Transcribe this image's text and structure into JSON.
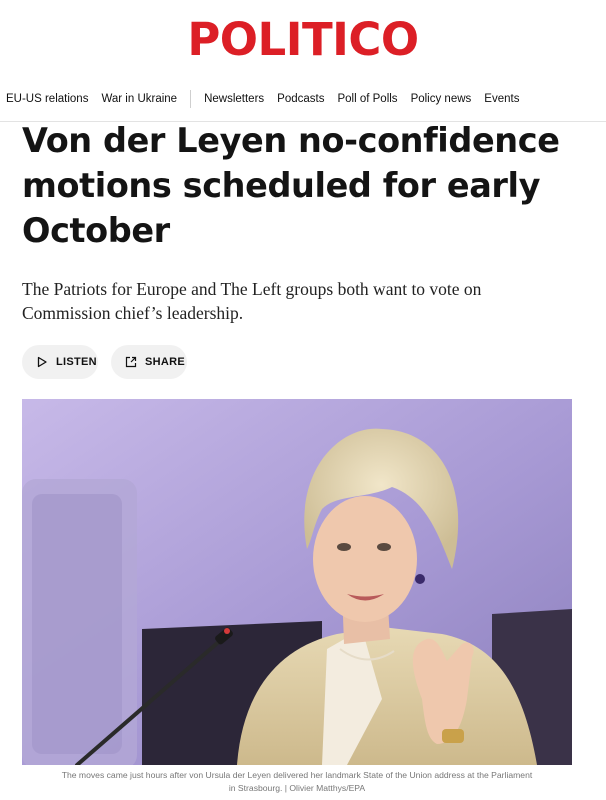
{
  "brand": {
    "name": "POLITICO",
    "color": "#dc1f26"
  },
  "nav": {
    "topics": [
      "EU-US relations",
      "War in Ukraine"
    ],
    "links": [
      "Newsletters",
      "Podcasts",
      "Poll of Polls",
      "Policy news",
      "Events"
    ]
  },
  "article": {
    "headline_lines": [
      "Von der Leyen no-confidence",
      "motions scheduled for early",
      "October"
    ],
    "dek_lines": [
      "The Patriots for Europe and The Left groups both want to vote on",
      "Commission chief’s leadership."
    ],
    "listen_label": "LISTEN",
    "share_label": "SHARE",
    "listen_icon": "play-triangle-icon",
    "share_icon": "share-arrow-icon",
    "photo": {
      "subject": "Ursula von der Leyen speaking at microphone",
      "caption_lines": [
        "The moves came just hours after von Ursula der Leyen delivered her landmark State of the Union address at the Parliament",
        "in Strasbourg. | Olivier Matthys/EPA"
      ]
    }
  }
}
